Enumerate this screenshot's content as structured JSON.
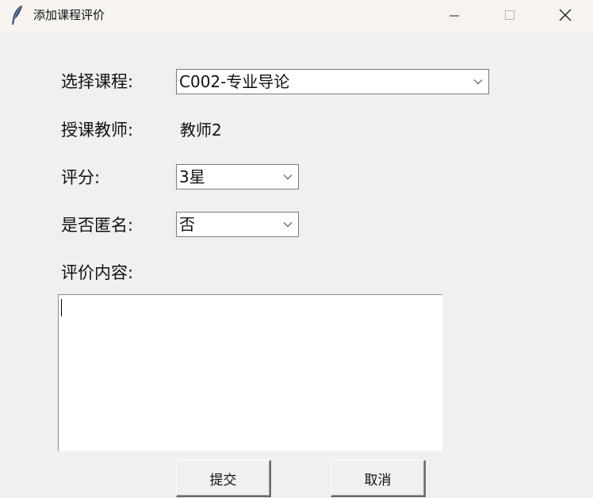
{
  "window": {
    "title": "添加课程评价",
    "icon": "feather-icon"
  },
  "form": {
    "course_label": "选择课程:",
    "course_value": "C002-专业导论",
    "teacher_label": "授课教师:",
    "teacher_value": "教师2",
    "rating_label": "评分:",
    "rating_value": "3星",
    "anonymous_label": "是否匿名:",
    "anonymous_value": "否",
    "content_label": "评价内容:",
    "content_value": ""
  },
  "buttons": {
    "submit_label": "提交",
    "cancel_label": "取消"
  }
}
